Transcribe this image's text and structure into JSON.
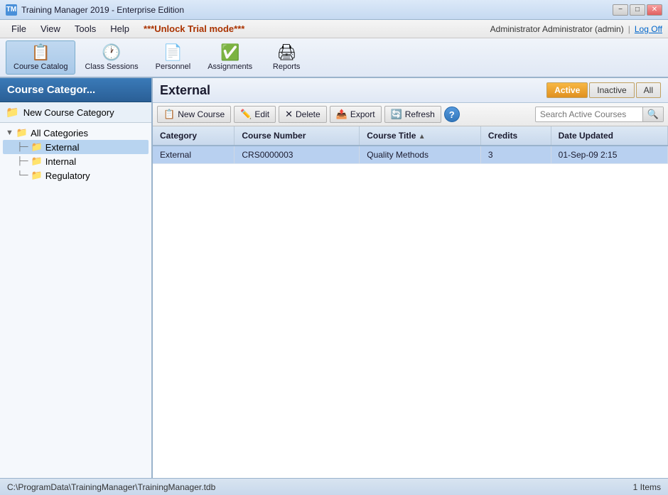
{
  "titleBar": {
    "icon": "TM",
    "title": "Training Manager 2019 - Enterprise Edition",
    "minimizeLabel": "−",
    "maximizeLabel": "□",
    "closeLabel": "✕"
  },
  "menuBar": {
    "items": [
      {
        "label": "File"
      },
      {
        "label": "View"
      },
      {
        "label": "Tools"
      },
      {
        "label": "Help"
      },
      {
        "label": "***Unlock Trial mode***"
      }
    ],
    "adminText": "Administrator Administrator (admin)",
    "pipe": "|",
    "logOffLabel": "Log Off"
  },
  "toolbar": {
    "buttons": [
      {
        "id": "course-catalog",
        "icon": "📋",
        "label": "Course Catalog",
        "active": true
      },
      {
        "id": "class-sessions",
        "icon": "🕐",
        "label": "Class Sessions",
        "active": false
      },
      {
        "id": "personnel",
        "icon": "📄",
        "label": "Personnel",
        "active": false
      },
      {
        "id": "assignments",
        "icon": "✅",
        "label": "Assignments",
        "active": false
      },
      {
        "id": "reports",
        "icon": "🖨",
        "label": "Reports",
        "active": false
      }
    ]
  },
  "leftPanel": {
    "header": "Course Categor...",
    "newCategoryLabel": "New Course Category",
    "tree": [
      {
        "level": 0,
        "label": "All Categories",
        "type": "folder",
        "expanded": true
      },
      {
        "level": 1,
        "label": "External",
        "type": "folder",
        "selected": true
      },
      {
        "level": 1,
        "label": "Internal",
        "type": "folder",
        "selected": false
      },
      {
        "level": 1,
        "label": "Regulatory",
        "type": "folder",
        "selected": false
      }
    ]
  },
  "rightPanel": {
    "title": "External",
    "statusButtons": [
      {
        "label": "Active",
        "active": true
      },
      {
        "label": "Inactive",
        "active": false
      },
      {
        "label": "All",
        "active": false
      }
    ],
    "actionBar": {
      "buttons": [
        {
          "icon": "📋",
          "label": "New Course"
        },
        {
          "icon": "✏️",
          "label": "Edit"
        },
        {
          "icon": "✕",
          "label": "Delete"
        },
        {
          "icon": "📤",
          "label": "Export"
        },
        {
          "icon": "🔄",
          "label": "Refresh"
        }
      ],
      "searchPlaceholder": "Search Active Courses",
      "helpIcon": "?"
    },
    "table": {
      "columns": [
        {
          "id": "category",
          "label": "Category",
          "sortable": false
        },
        {
          "id": "courseNumber",
          "label": "Course Number",
          "sortable": false
        },
        {
          "id": "courseTitle",
          "label": "Course Title",
          "sortable": true
        },
        {
          "id": "credits",
          "label": "Credits",
          "sortable": false
        },
        {
          "id": "dateUpdated",
          "label": "Date Updated",
          "sortable": false
        }
      ],
      "rows": [
        {
          "category": "External",
          "courseNumber": "CRS0000003",
          "courseTitle": "Quality Methods",
          "credits": "3",
          "dateUpdated": "01-Sep-09 2:15",
          "selected": true
        }
      ]
    }
  },
  "statusBar": {
    "path": "C:\\ProgramData\\TrainingManager\\TrainingManager.tdb",
    "itemCount": "1 Items"
  }
}
